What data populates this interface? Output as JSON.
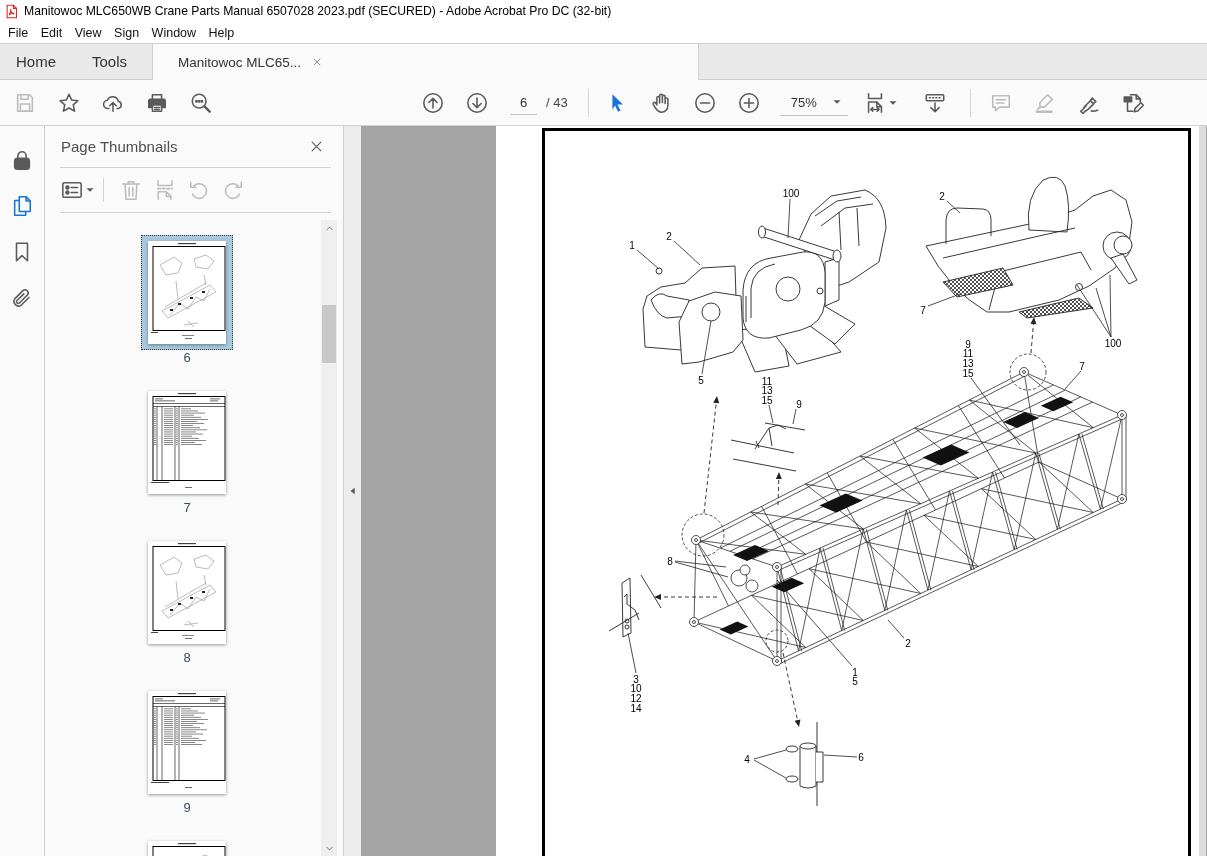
{
  "window": {
    "title": "Manitowoc MLC650WB Crane Parts Manual 6507028 2023.pdf (SECURED) - Adobe Acrobat Pro DC (32-bit)"
  },
  "menu": [
    "File",
    "Edit",
    "View",
    "Sign",
    "Window",
    "Help"
  ],
  "tabs": [
    {
      "label": "Home",
      "kind": "nav",
      "selected": false
    },
    {
      "label": "Tools",
      "kind": "nav",
      "selected": false
    },
    {
      "label": "Manitowoc MLC65...",
      "kind": "document",
      "selected": true
    }
  ],
  "toolbar": {
    "file_tools": [
      {
        "kind": "save",
        "disabled": true
      },
      {
        "kind": "star",
        "disabled": false
      },
      {
        "kind": "upload",
        "disabled": false
      },
      {
        "kind": "print",
        "disabled": false
      },
      {
        "kind": "find",
        "disabled": false
      }
    ],
    "page_field": {
      "value": "6"
    },
    "page_count": "/ 43",
    "view_tools": [
      {
        "kind": "select",
        "selected": true
      },
      {
        "kind": "hand",
        "selected": false
      }
    ],
    "zoom_field": {
      "value": "75%"
    },
    "edit_tools": [
      {
        "kind": "comment",
        "disabled": true
      },
      {
        "kind": "highlight",
        "disabled": true
      },
      {
        "kind": "sign",
        "disabled": false
      },
      {
        "kind": "edit",
        "disabled": false
      }
    ]
  },
  "rail": [
    {
      "kind": "lock",
      "selected": false
    },
    {
      "kind": "pages",
      "selected": true
    },
    {
      "kind": "bookmark",
      "selected": false
    },
    {
      "kind": "attachment",
      "selected": false
    }
  ],
  "sidebar": {
    "title": "Page Thumbnails",
    "tools": [
      {
        "kind": "options",
        "disabled": false
      },
      {
        "kind": "delete",
        "disabled": true
      },
      {
        "kind": "extract",
        "disabled": true
      },
      {
        "kind": "rotate_left",
        "disabled": true
      },
      {
        "kind": "rotate_right",
        "disabled": true
      }
    ],
    "thumbnails": [
      {
        "label": "6",
        "kind": "drawing",
        "selected": true
      },
      {
        "label": "7",
        "kind": "list",
        "selected": false
      },
      {
        "label": "8",
        "kind": "drawing",
        "selected": false
      },
      {
        "label": "9",
        "kind": "list",
        "selected": false
      },
      {
        "kind": "drawing",
        "selected": false
      }
    ]
  },
  "document": {
    "callouts": [
      {
        "lines": [
          "100"
        ]
      },
      {
        "lines": [
          "1"
        ]
      },
      {
        "lines": [
          "2"
        ]
      },
      {
        "lines": [
          "5"
        ]
      },
      {
        "lines": [
          "2"
        ]
      },
      {
        "lines": [
          "7"
        ]
      },
      {
        "lines": [
          "100"
        ]
      },
      {
        "lines": [
          "11",
          "13",
          "15"
        ]
      },
      {
        "lines": [
          "9"
        ]
      },
      {
        "lines": [
          "9",
          "11",
          "13",
          "15"
        ]
      },
      {
        "lines": [
          "7"
        ]
      },
      {
        "lines": [
          "8"
        ]
      },
      {
        "lines": [
          "3",
          "10",
          "12",
          "14"
        ]
      },
      {
        "lines": [
          "1",
          "5"
        ]
      },
      {
        "lines": [
          "2"
        ]
      },
      {
        "lines": [
          "4"
        ]
      },
      {
        "lines": [
          "6"
        ]
      }
    ]
  }
}
